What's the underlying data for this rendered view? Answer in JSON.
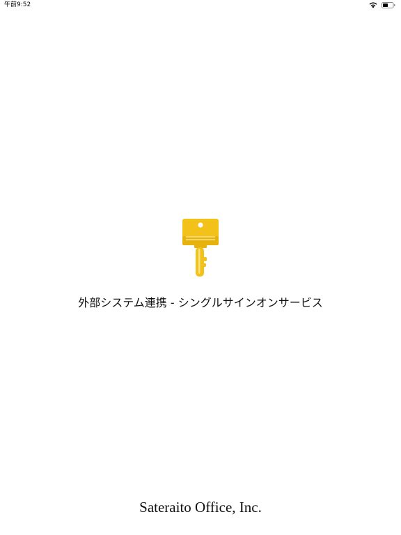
{
  "status_bar": {
    "time": "午前9:52",
    "wifi_icon": "wifi-icon",
    "battery_icon": "battery-icon"
  },
  "splash": {
    "logo_icon": "key-icon",
    "logo_color": "#F2C21B",
    "title": "外部システム連携 - シングルサインオンサービス",
    "company": "Sateraito Office, Inc."
  }
}
